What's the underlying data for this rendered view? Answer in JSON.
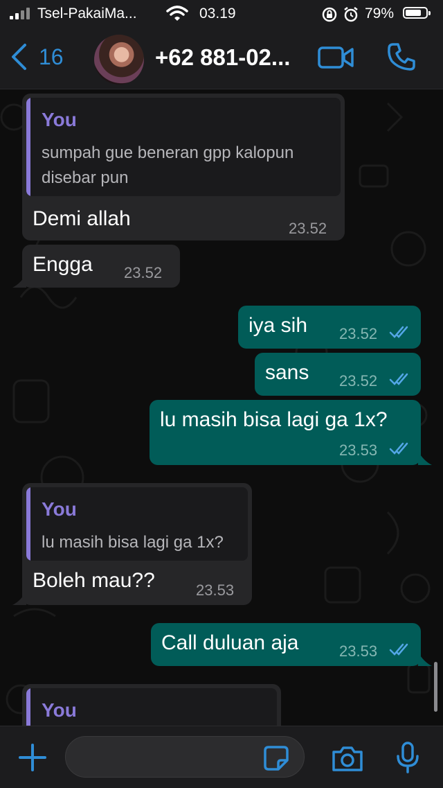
{
  "status_bar": {
    "carrier": "Tsel-PakaiMa...",
    "time": "03.19",
    "battery": "79%",
    "battery_level": 0.79
  },
  "header": {
    "back_count": "16",
    "contact_name": "+62 881-02...",
    "accent_color": "#2f8dd6"
  },
  "messages": [
    {
      "direction": "in",
      "quote_author": "You",
      "quote_text": [
        "sumpah gue beneran gpp kalopun",
        "disebar pun"
      ],
      "text": "Demi allah",
      "time": "23.52"
    },
    {
      "direction": "in",
      "text": "Engga",
      "time": "23.52"
    },
    {
      "direction": "out",
      "text": "iya sih",
      "time": "23.52",
      "status": "read"
    },
    {
      "direction": "out",
      "text": "sans",
      "time": "23.52",
      "status": "read"
    },
    {
      "direction": "out",
      "text": "lu masih bisa lagi ga 1x?",
      "time": "23.53",
      "status": "read"
    },
    {
      "direction": "in",
      "quote_author": "You",
      "quote_text": [
        "lu masih bisa lagi ga 1x?"
      ],
      "text": "Boleh mau??",
      "time": "23.53"
    },
    {
      "direction": "out",
      "text": "Call duluan aja",
      "time": "23.53",
      "status": "read"
    },
    {
      "direction": "in",
      "quote_author": "You",
      "quote_text": [],
      "text": "",
      "time": ""
    }
  ],
  "input": {
    "value": "",
    "placeholder": ""
  },
  "colors": {
    "incoming_bubble": "#262628",
    "outgoing_bubble": "#015c58",
    "quote_accent": "#8a7ad9",
    "read_ticks": "#53a6e6"
  }
}
